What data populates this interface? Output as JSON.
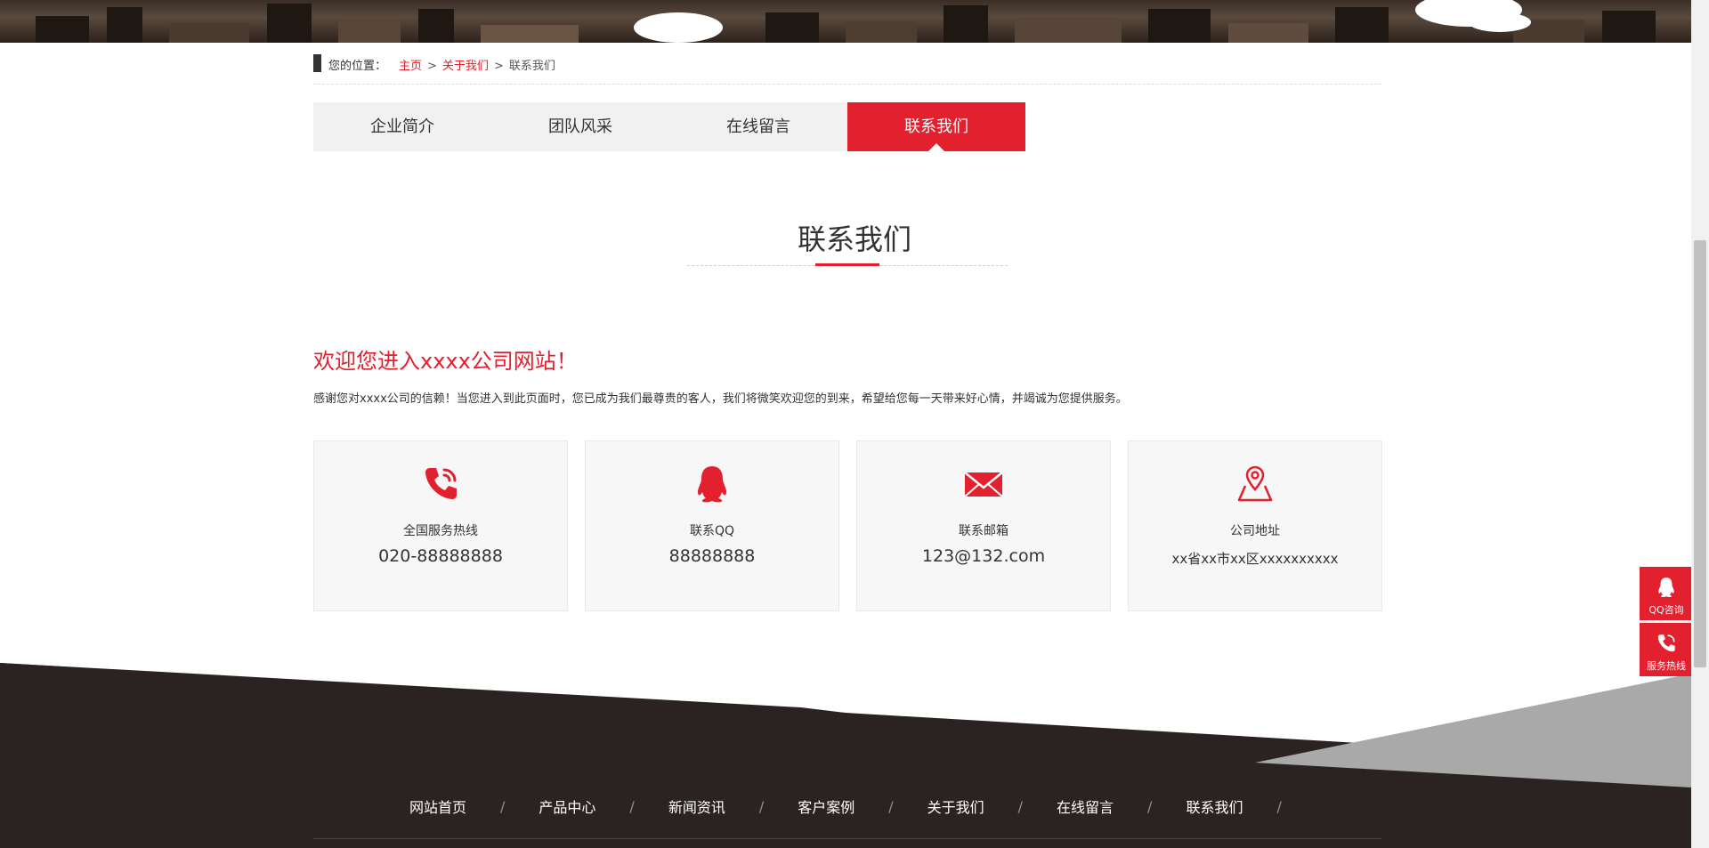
{
  "breadcrumb": {
    "label": "您的位置：",
    "items": [
      "主页",
      "关于我们",
      "联系我们"
    ],
    "separator": ">"
  },
  "tabs": [
    {
      "label": "企业简介",
      "active": false
    },
    {
      "label": "团队风采",
      "active": false
    },
    {
      "label": "在线留言",
      "active": false
    },
    {
      "label": "联系我们",
      "active": true
    }
  ],
  "section": {
    "title": "联系我们"
  },
  "welcome": {
    "heading": "欢迎您进入xxxx公司网站！",
    "text": "感谢您对xxxx公司的信赖！当您进入到此页面时，您已成为我们最尊贵的客人，我们将微笑欢迎您的到来，希望给您每一天带来好心情，并竭诚为您提供服务。"
  },
  "contacts": [
    {
      "icon": "phone-icon",
      "title": "全国服务热线",
      "value": "020-88888888"
    },
    {
      "icon": "qq-icon",
      "title": "联系QQ",
      "value": "88888888"
    },
    {
      "icon": "mail-icon",
      "title": "联系邮箱",
      "value": "123@132.com"
    },
    {
      "icon": "map-pin-icon",
      "title": "公司地址",
      "value": "xx省xx市xx区xxxxxxxxxx"
    }
  ],
  "footer_nav": [
    "网站首页",
    "产品中心",
    "新闻资讯",
    "客户案例",
    "关于我们",
    "在线留言",
    "联系我们"
  ],
  "footer_separator": "/",
  "side_buttons": [
    {
      "icon": "qq-icon",
      "label": "QQ咨询"
    },
    {
      "icon": "phone-icon",
      "label": "服务热线"
    }
  ],
  "colors": {
    "accent": "#e3202e",
    "footer_dark": "#2a2322",
    "card_bg": "#f7f7f7"
  }
}
